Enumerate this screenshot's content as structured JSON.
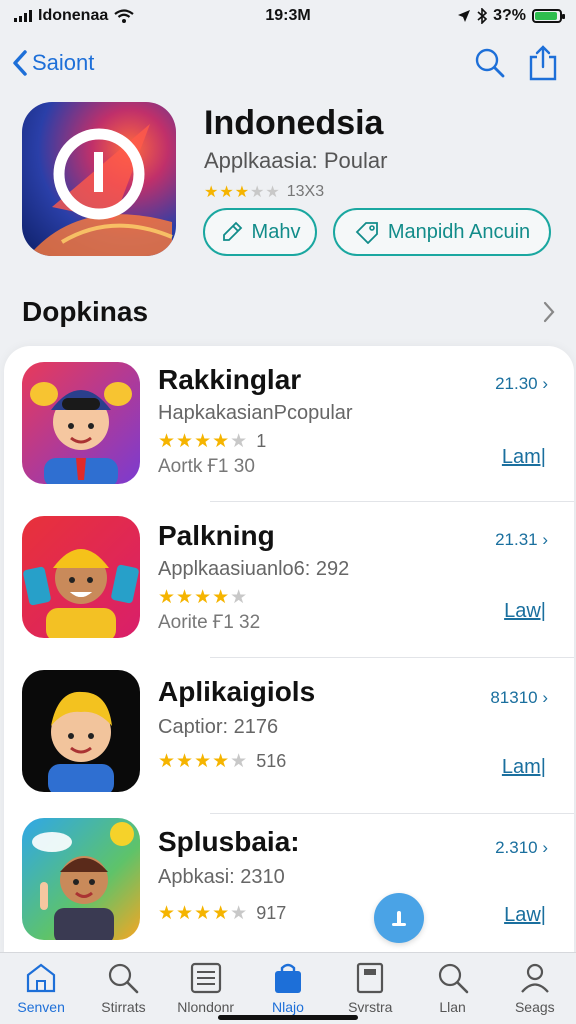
{
  "status_bar": {
    "carrier": "Idonenaa",
    "time": "19:3M",
    "battery": "3?%",
    "battery_level": 0.9
  },
  "nav": {
    "back_label": "Saiont",
    "icons": [
      "search-icon",
      "share-icon"
    ]
  },
  "hero": {
    "title": "Indonedsia",
    "subtitle": "Applkaasia: Poular",
    "rating_text": "13X3",
    "rating_stars": 3,
    "buttons": [
      {
        "label": "Mahv",
        "icon": "pencil-icon"
      },
      {
        "label": "Manpidh Ancuin",
        "icon": "tag-icon"
      }
    ]
  },
  "section": {
    "title": "Dopkinas",
    "chevron": "›"
  },
  "apps": [
    {
      "title": "Rakkinglar",
      "subtitle": "HapkakasianPcopular",
      "rating_stars": 4,
      "rating_text": "1",
      "meta": "Aortk  Ғ1  30",
      "price": "21.30 ›",
      "get_label": "Lam|"
    },
    {
      "title": "Palkning",
      "subtitle": "Applkaasiuanlo6: 292",
      "rating_stars": 4,
      "rating_text": "",
      "meta": "Aorite  Ғ1  32",
      "price": "21.31 ›",
      "get_label": "Law|"
    },
    {
      "title": "Aplikaigiols",
      "subtitle": "Captior: 2176",
      "rating_stars": 4,
      "rating_text": "516",
      "meta": "",
      "price": "81310 ›",
      "get_label": "Lam|"
    },
    {
      "title": "Splusbaia:",
      "subtitle": "Apbkasi: 2310",
      "rating_stars": 4,
      "rating_text": "917",
      "meta": "",
      "price": "2.310 ›",
      "get_label": "Law|"
    }
  ],
  "tabs": [
    {
      "label": "Senven",
      "icon": "home-icon",
      "active": false
    },
    {
      "label": "Stirrats",
      "icon": "search-icon",
      "active": false
    },
    {
      "label": "Nlondonr",
      "icon": "list-icon",
      "active": false
    },
    {
      "label": "Nlajo",
      "icon": "bag-icon",
      "active": true
    },
    {
      "label": "Svrstra",
      "icon": "book-icon",
      "active": false
    },
    {
      "label": "Llan",
      "icon": "search-icon",
      "active": false
    },
    {
      "label": "Seags",
      "icon": "person-icon",
      "active": false
    }
  ],
  "colors": {
    "accent": "#1d6fd8",
    "teal": "#1aa7a0",
    "star": "#f5b400"
  }
}
